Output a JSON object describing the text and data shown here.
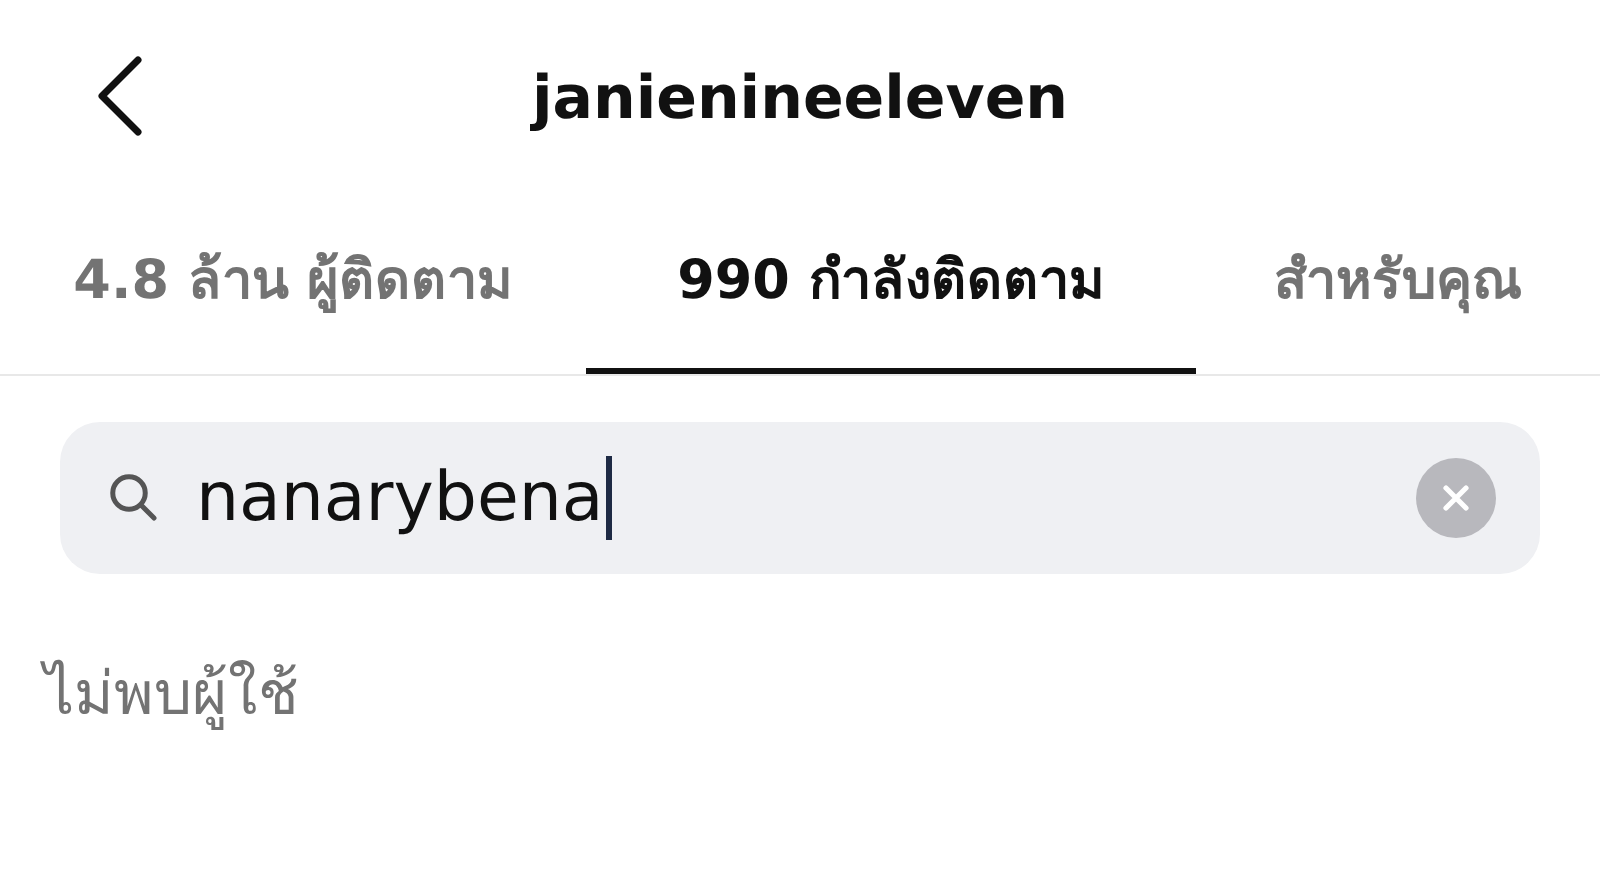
{
  "header": {
    "title": "janienineeleven"
  },
  "tabs": [
    {
      "label": "4.8 ล้าน ผู้ติดตาม",
      "selected": false
    },
    {
      "label": "990 กำลังติดตาม",
      "selected": true
    },
    {
      "label": "สำหรับคุณ",
      "selected": false
    }
  ],
  "search": {
    "value": "nanarybena"
  },
  "empty_message": "ไม่พบผู้ใช้"
}
